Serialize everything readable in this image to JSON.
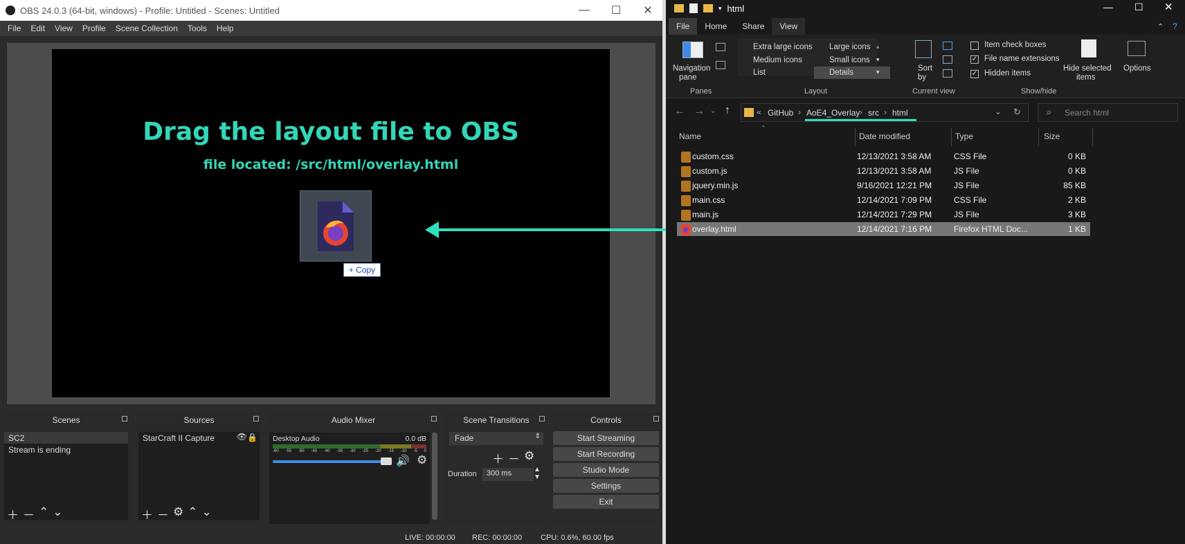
{
  "obs": {
    "title": "OBS 24.0.3 (64-bit, windows) - Profile: Untitled - Scenes: Untitled",
    "menu": [
      "File",
      "Edit",
      "View",
      "Profile",
      "Scene Collection",
      "Tools",
      "Help"
    ],
    "preview": {
      "headline": "Drag the layout file to OBS",
      "subline": "file located:  /src/html/overlay.html",
      "copy_label": "+ Copy"
    },
    "scenes": {
      "title": "Scenes",
      "items": [
        "SC2",
        "Stream is ending"
      ]
    },
    "sources": {
      "title": "Sources",
      "items": [
        "StarCraft II Capture"
      ]
    },
    "mixer": {
      "title": "Audio Mixer",
      "track": "Desktop Audio",
      "level": "0.0 dB",
      "ticks": [
        "-60",
        "-55",
        "-50",
        "-45",
        "-40",
        "-35",
        "-30",
        "-25",
        "-20",
        "-15",
        "-10",
        "-5",
        "0"
      ],
      "volume_fraction": 0.96
    },
    "transitions": {
      "title": "Scene Transitions",
      "selected": "Fade",
      "duration_label": "Duration",
      "duration_value": "300 ms"
    },
    "controls": {
      "title": "Controls",
      "buttons": [
        "Start Streaming",
        "Start Recording",
        "Studio Mode",
        "Settings",
        "Exit"
      ]
    },
    "status": {
      "live": "LIVE: 00:00:00",
      "rec": "REC: 00:00:00",
      "cpu": "CPU: 0.6%, 60.00 fps"
    }
  },
  "explorer": {
    "title": "html",
    "tabs": [
      "File",
      "Home",
      "Share",
      "View"
    ],
    "ribbon": {
      "panes": {
        "label": "Panes",
        "nav": "Navigation",
        "nav2": "pane"
      },
      "layout": {
        "label": "Layout",
        "options": [
          "Extra large icons",
          "Large icons",
          "Medium icons",
          "Small icons",
          "List",
          "Details"
        ],
        "selected": "Details"
      },
      "current_view": {
        "label": "Current view",
        "sort": "Sort",
        "sort2": "by"
      },
      "show_hide": {
        "label": "Show/hide",
        "checks": [
          {
            "label": "Item check boxes",
            "checked": false
          },
          {
            "label": "File name extensions",
            "checked": true
          },
          {
            "label": "Hidden items",
            "checked": true
          }
        ],
        "hide_selected": "Hide selected",
        "hide_selected2": "items"
      },
      "options": "Options"
    },
    "breadcrumb": [
      "GitHub",
      "AoE4_Overlay",
      "src",
      "html"
    ],
    "search_placeholder": "Search html",
    "columns": [
      "Name",
      "Date modified",
      "Type",
      "Size"
    ],
    "files": [
      {
        "name": "custom.css",
        "date": "12/13/2021 3:58 AM",
        "type": "CSS File",
        "size": "0 KB"
      },
      {
        "name": "custom.js",
        "date": "12/13/2021 3:58 AM",
        "type": "JS File",
        "size": "0 KB"
      },
      {
        "name": "jquery.min.js",
        "date": "9/16/2021 12:21 PM",
        "type": "JS File",
        "size": "85 KB"
      },
      {
        "name": "main.css",
        "date": "12/14/2021 7:09 PM",
        "type": "CSS File",
        "size": "2 KB"
      },
      {
        "name": "main.js",
        "date": "12/14/2021 7:29 PM",
        "type": "JS File",
        "size": "3 KB"
      },
      {
        "name": "overlay.html",
        "date": "12/14/2021 7:16 PM",
        "type": "Firefox HTML Doc...",
        "size": "1 KB",
        "selected": true
      }
    ]
  },
  "accent": "#33d6b7"
}
